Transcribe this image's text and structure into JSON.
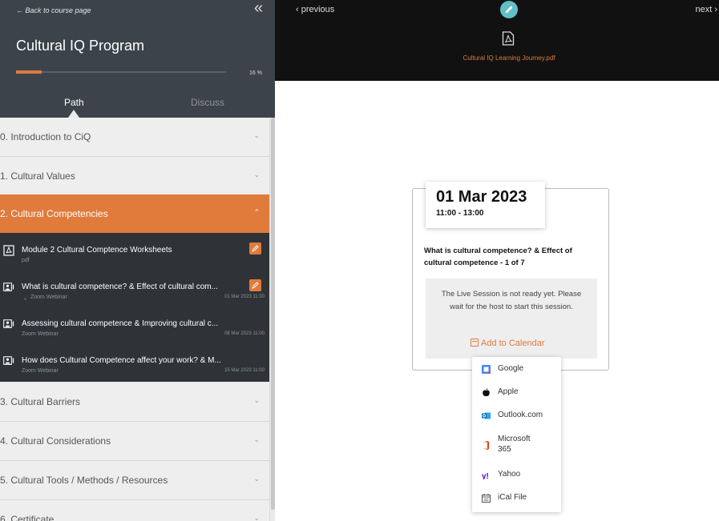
{
  "sidebar": {
    "back_label": "← Back to course page",
    "collapse_glyph": "«",
    "program_title": "Cultural IQ Program",
    "progress_percent": 16,
    "progress_label": "16 %",
    "tabs": [
      {
        "label": "Path",
        "active": true
      },
      {
        "label": "Discuss",
        "active": false
      }
    ],
    "sections": [
      {
        "label": "0. Introduction to CiQ",
        "expanded": false
      },
      {
        "label": "1. Cultural Values",
        "expanded": false
      },
      {
        "label": "2. Cultural Competencies",
        "expanded": true
      },
      {
        "label": "3. Cultural Barriers",
        "expanded": false
      },
      {
        "label": "4. Cultural Considerations",
        "expanded": false
      },
      {
        "label": "5. Cultural Tools / Methods / Resources",
        "expanded": false
      },
      {
        "label": "6. Certificate",
        "expanded": false
      }
    ],
    "modules": [
      {
        "icon": "pdf-icon",
        "title": "Module 2 Cultural Comptence Worksheets",
        "subtitle": "pdf",
        "date": "",
        "editable": true
      },
      {
        "icon": "webinar-icon",
        "title": "What is cultural competence? & Effect of cultural com...",
        "subtitle": "Zoom Webinar",
        "date": "01 Mar 2023 11:00",
        "editable": true
      },
      {
        "icon": "webinar-icon",
        "title": "Assessing cultural competence & Improving cultural c...",
        "subtitle": "Zoom Webinar",
        "date": "08 Mar 2023 11:00",
        "editable": false
      },
      {
        "icon": "webinar-icon",
        "title": "How does Cultural Competence affect your work? & M...",
        "subtitle": "Zoom Webinar",
        "date": "15 Mar 2023 11:00",
        "editable": false
      }
    ],
    "chevron_down": "⌄",
    "chevron_up": "⌃"
  },
  "topbar": {
    "previous_label": "‹ previous",
    "next_label": "next ›",
    "file_name": "Cultural IQ Learning Journey.pdf"
  },
  "session": {
    "date": "01 Mar 2023",
    "time": "11:00 - 13:00",
    "title": "What is cultural competence? & Effect of cultural competence - 1 of 7",
    "status": "The Live Session is not ready yet. Please wait for the host to start this session.",
    "add_to_calendar": "Add to Calendar"
  },
  "calendar_menu": [
    {
      "label": "Google",
      "icon": "google-calendar-icon"
    },
    {
      "label": "Apple",
      "icon": "apple-icon"
    },
    {
      "label": "Outlook.com",
      "icon": "outlook-icon"
    },
    {
      "label": "Microsoft 365",
      "icon": "microsoft-365-icon"
    },
    {
      "label": "Yahoo",
      "icon": "yahoo-icon"
    },
    {
      "label": "iCal File",
      "icon": "ical-file-icon"
    }
  ],
  "colors": {
    "accent": "#e07b3c",
    "sidebar_header": "#3d434a",
    "module_bg": "#2f3337",
    "topbar_bg": "#111111",
    "edit_circle": "#5fc0c6"
  }
}
